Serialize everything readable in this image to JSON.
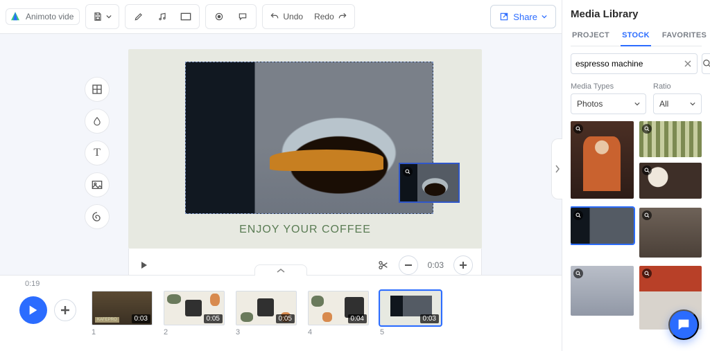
{
  "header": {
    "project_name": "Animoto vide",
    "undo_label": "Undo",
    "redo_label": "Redo",
    "share_label": "Share"
  },
  "canvas": {
    "caption": "ENJOY YOUR COFFEE",
    "current_time": "0:03"
  },
  "timeline": {
    "total": "0:19",
    "slides": [
      {
        "index": "1",
        "duration": "0:03"
      },
      {
        "index": "2",
        "duration": "0:05"
      },
      {
        "index": "3",
        "duration": "0:05"
      },
      {
        "index": "4",
        "duration": "0:04"
      },
      {
        "index": "5",
        "duration": "0:03"
      }
    ],
    "selected_index": 4
  },
  "sidebar": {
    "title": "Media Library",
    "tabs": {
      "project": "PROJECT",
      "stock": "STOCK",
      "favorites": "FAVORITES"
    },
    "active_tab": "stock",
    "search_value": "espresso machine",
    "filters": {
      "media_types": {
        "label": "Media Types",
        "value": "Photos"
      },
      "ratio": {
        "label": "Ratio",
        "value": "All"
      }
    },
    "selected_result_index": 3
  }
}
